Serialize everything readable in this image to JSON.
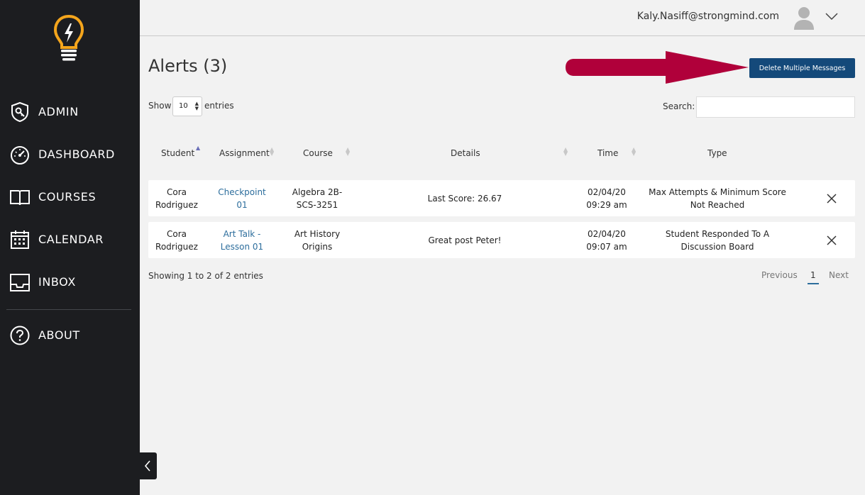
{
  "nav": {
    "items": [
      {
        "label": "ADMIN",
        "icon": "shield-key-icon"
      },
      {
        "label": "DASHBOARD",
        "icon": "speedometer-icon"
      },
      {
        "label": "COURSES",
        "icon": "open-book-icon"
      },
      {
        "label": "CALENDAR",
        "icon": "calendar-icon"
      },
      {
        "label": "INBOX",
        "icon": "inbox-tray-icon"
      },
      {
        "label": "ABOUT",
        "icon": "question-circle-icon"
      }
    ]
  },
  "header": {
    "email": "Kaly.Nasiff@strongmind.com"
  },
  "page": {
    "title": "Alerts (3)",
    "delete_label": "Delete Multiple Messages"
  },
  "controls": {
    "show_label": "Show",
    "entries_value": "10",
    "entries_label": "entries",
    "search_label": "Search:",
    "search_value": ""
  },
  "table": {
    "headers": [
      "Student",
      "Assignment",
      "Course",
      "Details",
      "Time",
      "Type"
    ],
    "rows": [
      {
        "student": [
          "Cora",
          "Rodriguez"
        ],
        "assignment": [
          "Checkpoint",
          "01"
        ],
        "course": [
          "Algebra 2B-",
          "SCS-3251"
        ],
        "details": "Last Score: 26.67",
        "time": [
          "02/04/20",
          "09:29 am"
        ],
        "type": [
          "Max Attempts & Minimum Score",
          "Not Reached"
        ]
      },
      {
        "student": [
          "Cora",
          "Rodriguez"
        ],
        "assignment": [
          "Art Talk -",
          "Lesson 01"
        ],
        "course": [
          "Art History",
          "Origins"
        ],
        "details": "Great post Peter!",
        "time": [
          "02/04/20",
          "09:07 am"
        ],
        "type": [
          "Student Responded To A",
          "Discussion Board"
        ]
      }
    ]
  },
  "footer": {
    "showing": "Showing 1 to 2 of 2 entries",
    "previous": "Previous",
    "page": "1",
    "next": "Next"
  },
  "colors": {
    "sidebar": "#1c1d20",
    "accent_button": "#14497a",
    "link": "#2c6d9c",
    "logo": "#f4a51c",
    "arrow": "#b0003a"
  }
}
